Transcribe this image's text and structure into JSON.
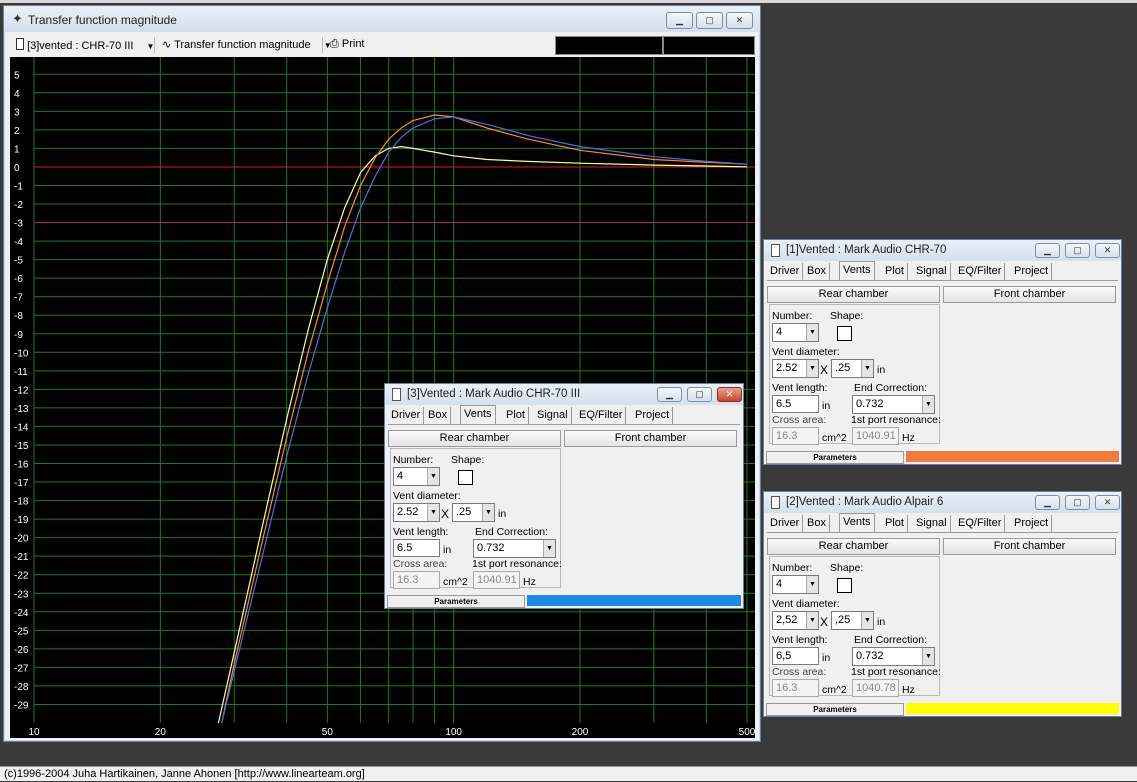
{
  "main_window": {
    "title": "Transfer function magnitude",
    "toolbar": {
      "driver_select": "[3]vented : CHR-70 III",
      "view_select": "Transfer function magnitude",
      "print_label": "Print"
    }
  },
  "chart_data": {
    "type": "line",
    "x_scale": "log",
    "xlim": [
      10,
      500
    ],
    "ylim": [
      -30,
      5.5
    ],
    "x_ticks": [
      "10",
      "20",
      "50",
      "100",
      "200",
      "500"
    ],
    "x_tick_values": [
      10,
      20,
      50,
      100,
      200,
      500
    ],
    "y_ticks": [
      "5",
      "4",
      "3",
      "2",
      "1",
      "0",
      "-1",
      "-2",
      "-3",
      "-4",
      "-5",
      "-6",
      "-7",
      "-8",
      "-9",
      "-10",
      "-11",
      "-12",
      "-13",
      "-14",
      "-15",
      "-16",
      "-17",
      "-18",
      "-19",
      "-20",
      "-21",
      "-22",
      "-23",
      "-24",
      "-25",
      "-26",
      "-27",
      "-28",
      "-29"
    ],
    "grid": true,
    "reference_lines": [
      {
        "y": 0,
        "color": "#cc2222"
      },
      {
        "y": -3,
        "color": "#aa2266"
      }
    ],
    "series": [
      {
        "color": "#ffff99",
        "x": [
          27.5,
          30,
          35,
          40,
          45,
          50,
          55,
          60,
          65,
          70,
          75,
          80,
          90,
          100,
          120,
          150,
          200,
          300,
          400,
          500
        ],
        "y": [
          -30,
          -26.2,
          -19.4,
          -13.6,
          -8.8,
          -5.0,
          -2.2,
          -0.3,
          0.6,
          1.0,
          1.1,
          1.0,
          0.8,
          0.6,
          0.4,
          0.3,
          0.2,
          0.1,
          0.05,
          0.0
        ]
      },
      {
        "color": "#ff8833",
        "x": [
          28,
          30,
          35,
          40,
          45,
          50,
          55,
          60,
          65,
          70,
          75,
          80,
          90,
          100,
          120,
          150,
          200,
          300,
          400,
          500
        ],
        "y": [
          -30,
          -26.8,
          -20.2,
          -14.6,
          -10.0,
          -6.3,
          -3.2,
          -1.0,
          0.5,
          1.5,
          2.1,
          2.5,
          2.8,
          2.7,
          2.1,
          1.5,
          0.9,
          0.4,
          0.25,
          0.15
        ]
      },
      {
        "color": "#4f6fe0",
        "x": [
          28,
          30,
          35,
          40,
          45,
          50,
          55,
          60,
          65,
          70,
          75,
          80,
          90,
          100,
          120,
          150,
          200,
          300,
          400,
          500
        ],
        "y": [
          -30,
          -27.2,
          -21.0,
          -15.6,
          -11.2,
          -7.6,
          -4.6,
          -2.2,
          -0.5,
          0.8,
          1.6,
          2.1,
          2.6,
          2.7,
          2.3,
          1.7,
          1.1,
          0.55,
          0.3,
          0.15
        ]
      }
    ]
  },
  "param_windows": [
    {
      "title": "[3]Vented : Mark Audio CHR-70 III",
      "tabs": [
        "Driver",
        "Box",
        "Vents",
        "Plot",
        "Signal",
        "EQ/Filter",
        "Project"
      ],
      "rear_chamber": "Rear chamber",
      "front_chamber": "Front chamber",
      "number_label": "Number:",
      "number_value": "4",
      "shape_label": "Shape:",
      "vent_diameter_label": "Vent diameter:",
      "vent_diameter_value": "2.52",
      "vent_x": "X",
      "vent_diameter_2": ".25",
      "unit_in": "in",
      "vent_length_label": "Vent length:",
      "vent_length_value": "6.5",
      "end_correction_label": "End Correction:",
      "end_correction_value": "0.732",
      "cross_area_label": "Cross area:",
      "cross_area_value": "16.3",
      "cross_area_unit": "cm^2",
      "resonance_label": "1st port resonance:",
      "resonance_value": "1040.91",
      "resonance_unit": "Hz",
      "status_label": "Parameters",
      "status_color": "#1e88e5"
    },
    {
      "title": "[1]Vented : Mark Audio CHR-70",
      "tabs": [
        "Driver",
        "Box",
        "Vents",
        "Plot",
        "Signal",
        "EQ/Filter",
        "Project"
      ],
      "rear_chamber": "Rear chamber",
      "front_chamber": "Front chamber",
      "number_label": "Number:",
      "number_value": "4",
      "shape_label": "Shape:",
      "vent_diameter_label": "Vent diameter:",
      "vent_diameter_value": "2.52",
      "vent_x": "X",
      "vent_diameter_2": ".25",
      "unit_in": "in",
      "vent_length_label": "Vent length:",
      "vent_length_value": "6.5",
      "end_correction_label": "End Correction:",
      "end_correction_value": "0.732",
      "cross_area_label": "Cross area:",
      "cross_area_value": "16.3",
      "cross_area_unit": "cm^2",
      "resonance_label": "1st port resonance:",
      "resonance_value": "1040.91",
      "resonance_unit": "Hz",
      "status_label": "Parameters",
      "status_color": "#f07b3f"
    },
    {
      "title": "[2]Vented : Mark Audio Alpair 6",
      "tabs": [
        "Driver",
        "Box",
        "Vents",
        "Plot",
        "Signal",
        "EQ/Filter",
        "Project"
      ],
      "rear_chamber": "Rear chamber",
      "front_chamber": "Front chamber",
      "number_label": "Number:",
      "number_value": "4",
      "shape_label": "Shape:",
      "vent_diameter_label": "Vent diameter:",
      "vent_diameter_value": "2,52",
      "vent_x": "X",
      "vent_diameter_2": ",25",
      "unit_in": "in",
      "vent_length_label": "Vent length:",
      "vent_length_value": "6,5",
      "end_correction_label": "End Correction:",
      "end_correction_value": "0.732",
      "cross_area_label": "Cross area:",
      "cross_area_value": "16.3",
      "cross_area_unit": "cm^2",
      "resonance_label": "1st port resonance:",
      "resonance_value": "1040.78",
      "resonance_unit": "Hz",
      "status_label": "Parameters",
      "status_color": "#ffff00"
    }
  ],
  "footer": "(c)1996-2004 Juha Hartikainen, Janne Ahonen [http://www.linearteam.org]"
}
